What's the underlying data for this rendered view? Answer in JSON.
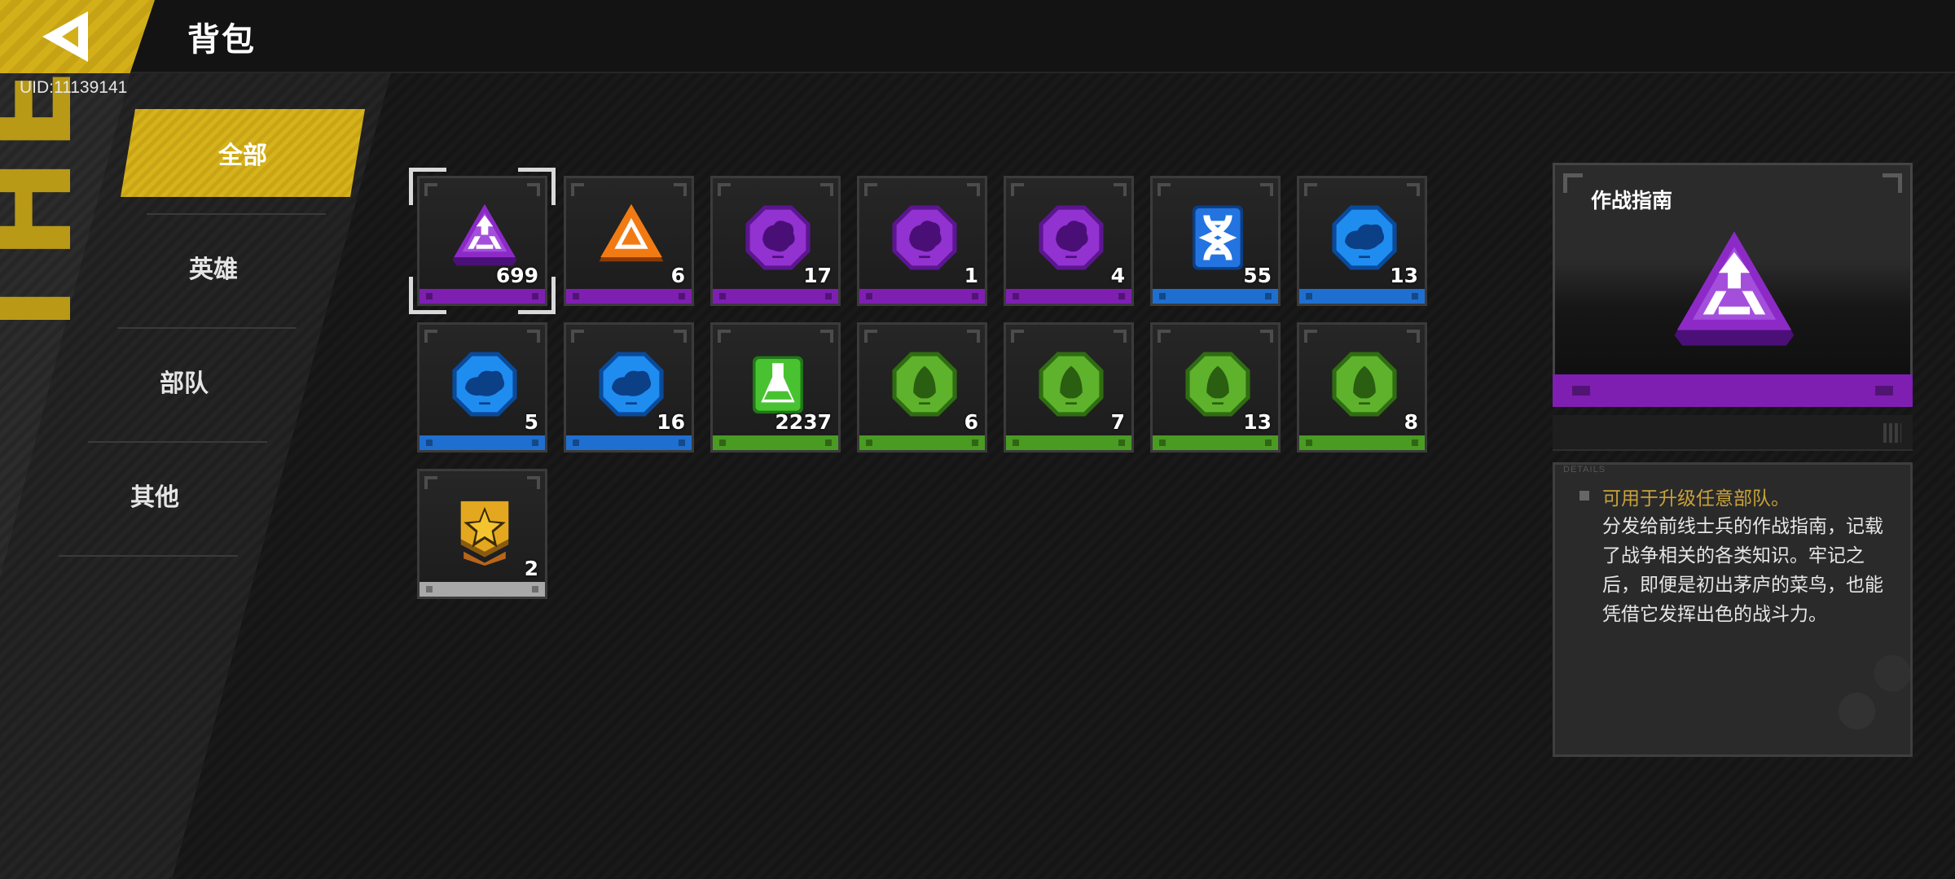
{
  "header": {
    "title": "背包",
    "back_icon": "back-arrow-icon"
  },
  "user": {
    "uid": "UID:11139141"
  },
  "sidebar": {
    "watermark": "THE WAR",
    "categories": [
      {
        "label": "全部",
        "active": true
      },
      {
        "label": "英雄",
        "active": false
      },
      {
        "label": "部队",
        "active": false
      },
      {
        "label": "其他",
        "active": false
      }
    ]
  },
  "rarity_colors": {
    "purple": "#7e1fb2",
    "orange": "#7e1fb2",
    "blue": "#1f6fd0",
    "green": "#4a9b22",
    "gray": "#a8a8a8"
  },
  "items": [
    {
      "count": "699",
      "icon": "purple-triangle-icon",
      "rarity": "purple",
      "selected": true
    },
    {
      "count": "6",
      "icon": "orange-triangle-icon",
      "rarity": "purple"
    },
    {
      "count": "17",
      "icon": "purple-map-icon",
      "rarity": "purple"
    },
    {
      "count": "1",
      "icon": "purple-map-icon",
      "rarity": "purple"
    },
    {
      "count": "4",
      "icon": "purple-map-icon",
      "rarity": "purple"
    },
    {
      "count": "55",
      "icon": "blue-dna-icon",
      "rarity": "blue"
    },
    {
      "count": "13",
      "icon": "blue-map-icon",
      "rarity": "blue"
    },
    {
      "count": "5",
      "icon": "blue-map-icon",
      "rarity": "blue"
    },
    {
      "count": "16",
      "icon": "blue-map-icon",
      "rarity": "blue"
    },
    {
      "count": "2237",
      "icon": "green-flask-icon",
      "rarity": "green"
    },
    {
      "count": "6",
      "icon": "green-map-icon",
      "rarity": "green"
    },
    {
      "count": "7",
      "icon": "green-map-icon",
      "rarity": "green"
    },
    {
      "count": "13",
      "icon": "green-map-icon",
      "rarity": "green"
    },
    {
      "count": "8",
      "icon": "green-map-icon",
      "rarity": "green"
    },
    {
      "count": "2",
      "icon": "gold-star-medal-icon",
      "rarity": "gray"
    }
  ],
  "detail": {
    "name": "作战指南",
    "tag": "DETAILS",
    "highlight": "可用于升级任意部队。",
    "description": "分发给前线士兵的作战指南，记载了战争相关的各类知识。牢记之后，即便是初出茅庐的菜鸟，也能凭借它发挥出色的战斗力。"
  }
}
